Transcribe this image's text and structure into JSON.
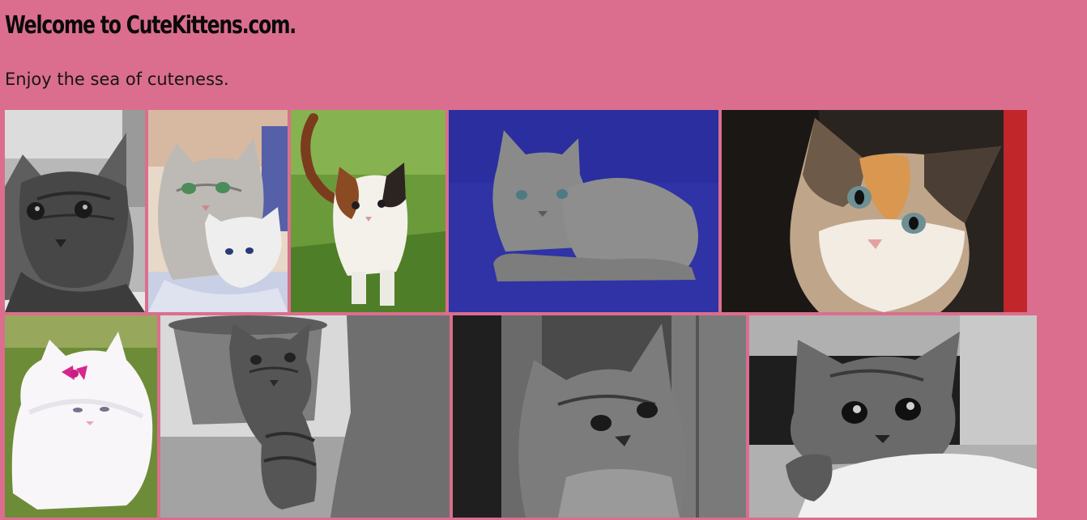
{
  "header": {
    "title": "Welcome to CuteKittens.com.",
    "tagline": "Enjoy the sea of cuteness."
  },
  "gallery": {
    "photos": [
      {
        "subject": "gray tabby kitten, black and white photo"
      },
      {
        "subject": "silver cat with white kitten"
      },
      {
        "subject": "calico kitten in grass"
      },
      {
        "subject": "gray kitten on blue background"
      },
      {
        "subject": "calico kitten close-up"
      },
      {
        "subject": "white fluffy kitten with pink bow"
      },
      {
        "subject": "tabby kitten by flower pot, black and white"
      },
      {
        "subject": "tabby kitten by wooden wall, black and white"
      },
      {
        "subject": "fluffy kitten on blanket, black and white"
      }
    ]
  },
  "colors": {
    "background": "#db6e8e"
  }
}
